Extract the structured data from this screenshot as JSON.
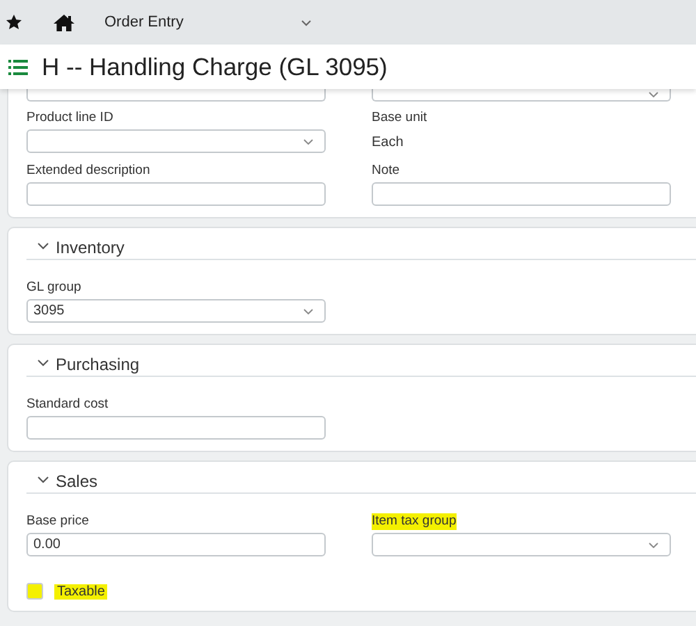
{
  "topbar": {
    "menu": "Order Entry"
  },
  "title": "H -- Handling Charge (GL 3095)",
  "sections": [
    {
      "rows": [
        [
          {
            "kind": "text"
          },
          {
            "kind": "select"
          }
        ],
        [
          {
            "kind": "select",
            "label": "Product line ID"
          },
          {
            "kind": "readonly",
            "label": "Base unit",
            "value": "Each"
          }
        ],
        [
          {
            "kind": "text",
            "label": "Extended description"
          },
          {
            "kind": "text",
            "label": "Note"
          }
        ]
      ]
    },
    {
      "heading": "Inventory",
      "expanded": true,
      "rows": [
        [
          {
            "kind": "select",
            "label": "GL group",
            "value": "3095"
          }
        ]
      ]
    },
    {
      "heading": "Purchasing",
      "expanded": true,
      "rows": [
        [
          {
            "kind": "text",
            "label": "Standard cost"
          }
        ]
      ]
    },
    {
      "heading": "Sales",
      "expanded": true,
      "rows": [
        [
          {
            "kind": "text",
            "label": "Base price",
            "value": "0.00"
          },
          {
            "kind": "select",
            "label": "Item tax group",
            "highlighted": true
          }
        ],
        [
          {
            "kind": "checkbox",
            "label": "Taxable",
            "checked": false,
            "highlighted": true
          }
        ]
      ]
    }
  ]
}
